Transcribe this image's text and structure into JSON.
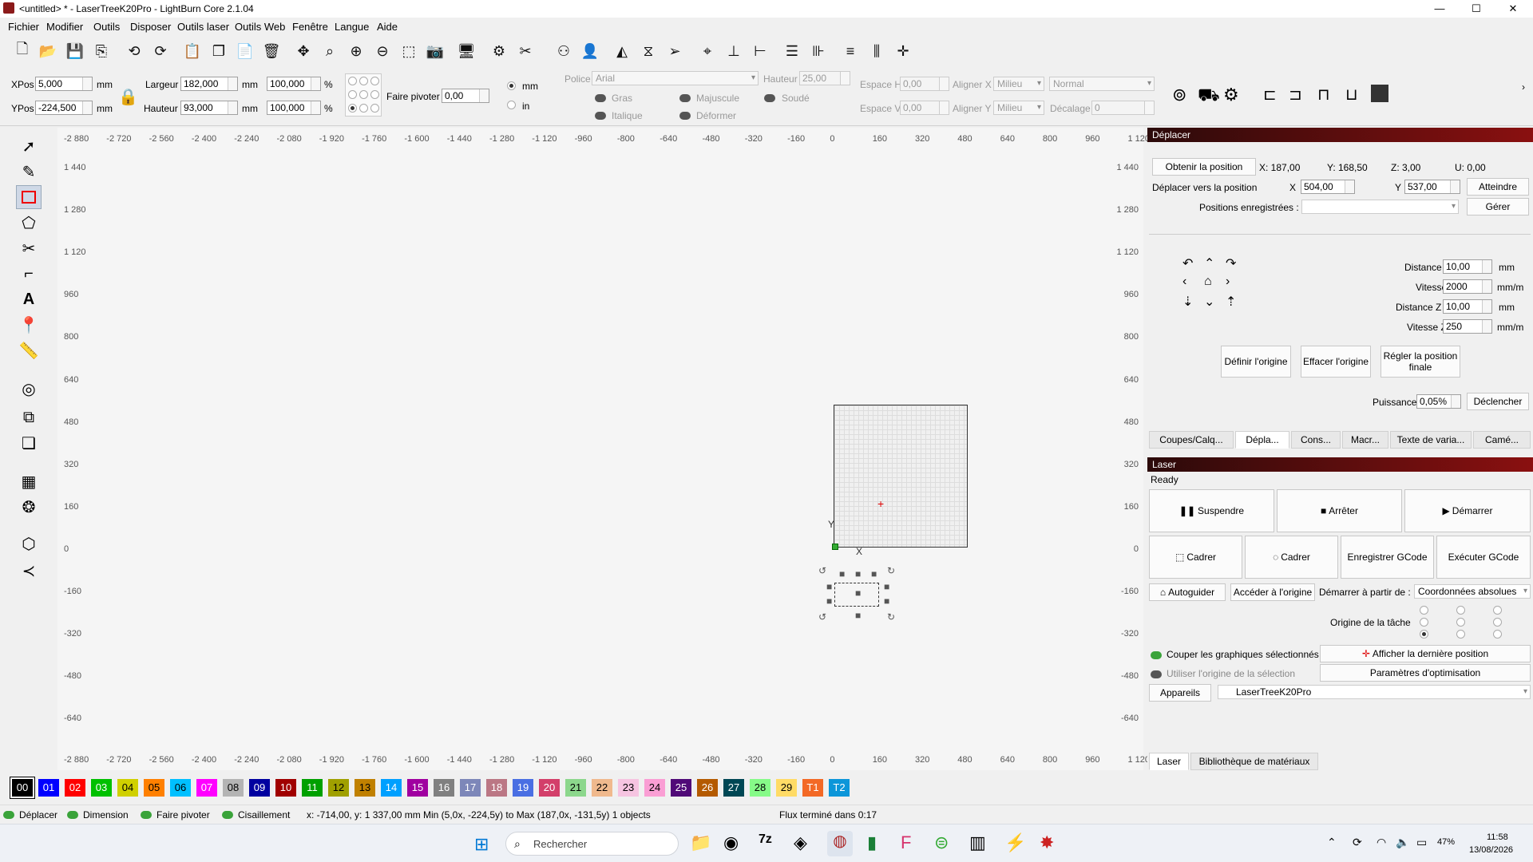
{
  "window": {
    "title": "<untitled> * - LaserTreeK20Pro - LightBurn Core 2.1.04",
    "min": "—",
    "max": "☐",
    "close": "✕"
  },
  "menu": [
    "Fichier",
    "Modifier",
    "Outils",
    "Disposer",
    "Outils laser",
    "Outils Web",
    "Fenêtre",
    "Langue",
    "Aide"
  ],
  "props": {
    "xpos_label": "XPos",
    "xpos": "5,000",
    "ypos_label": "YPos",
    "ypos": "-224,500",
    "unit_mm": "mm",
    "largeur_label": "Largeur",
    "largeur": "182,000",
    "hauteur_label": "Hauteur",
    "hauteur": "93,000",
    "pct1": "100,000",
    "pct2": "100,000",
    "pct_sign": "%",
    "rotate_label": "Faire pivoter",
    "rotate": "0,00",
    "radio_mm": "mm",
    "radio_in": "in",
    "police_label": "Police",
    "police": "Arial",
    "hauteur_font_label": "Hauteur",
    "hauteur_font": "25,00",
    "gras": "Gras",
    "italique": "Italique",
    "majuscule": "Majuscule",
    "deformer": "Déformer",
    "soude": "Soudé",
    "espace_h_label": "Espace H",
    "espace_h": "0,00",
    "espace_v_label": "Espace V",
    "espace_v": "0,00",
    "aligner_x_label": "Aligner X",
    "aligner_x": "Milieu",
    "aligner_y_label": "Aligner Y",
    "aligner_y": "Milieu",
    "normal": "Normal",
    "decalage_label": "Décalage",
    "decalage": "0"
  },
  "ruler": {
    "top": [
      "-2 880",
      "-2 720",
      "-2 560",
      "-2 400",
      "-2 240",
      "-2 080",
      "-1 920",
      "-1 760",
      "-1 600",
      "-1 440",
      "-1 280",
      "-1 120",
      "-960",
      "-800",
      "-640",
      "-480",
      "-320",
      "-160",
      "0",
      "160",
      "320",
      "480",
      "640",
      "800",
      "960",
      "1 120"
    ],
    "left": [
      "1 440",
      "1 280",
      "1 120",
      "960",
      "800",
      "640",
      "480",
      "320",
      "160",
      "0",
      "-160",
      "-320",
      "-480",
      "-640"
    ],
    "axis_x": "X",
    "axis_y": "Y"
  },
  "move_panel": {
    "title": "Déplacer",
    "get_pos": "Obtenir la position",
    "x": "X: 187,00",
    "y": "Y: 168,50",
    "z": "Z: 3,00",
    "u": "U: 0,00",
    "move_to": "Déplacer vers la position",
    "mx_label": "X",
    "mx": "504,00",
    "my_label": "Y",
    "my": "537,00",
    "goto": "Atteindre",
    "saved_label": "Positions enregistrées :",
    "manage": "Gérer",
    "distance_label": "Distance",
    "distance": "10,00",
    "vitesse_label": "Vitesse",
    "vitesse": "2000",
    "distz_label": "Distance Z",
    "distz": "10,00",
    "vitz_label": "Vitesse Z",
    "vitz": "250",
    "mm": "mm",
    "mmm": "mm/m",
    "set_origin": "Définir l'origine",
    "clear_origin": "Effacer l'origine",
    "set_home": "Régler la position finale",
    "power_label": "Puissance",
    "power": "0,05%",
    "fire": "Déclencher"
  },
  "tabs": [
    "Coupes/Calq...",
    "Dépla...",
    "Cons...",
    "Macr...",
    "Texte de varia...",
    "Camé..."
  ],
  "laser_panel": {
    "title": "Laser",
    "status": "Ready",
    "pause": "Suspendre",
    "stop": "Arrêter",
    "start": "Démarrer",
    "frame1": "Cadrer",
    "frame2": "Cadrer",
    "save_gcode": "Enregistrer GCode",
    "run_gcode": "Exécuter GCode",
    "home": "Autoguider",
    "goto_origin": "Accéder à l'origine",
    "start_from_label": "Démarrer à partir de :",
    "start_from": "Coordonnées absolues",
    "job_origin": "Origine de la tâche",
    "cut_selected": "Couper les graphiques sélectionnés",
    "use_sel_origin": "Utiliser l'origine de la sélection",
    "show_last": "Afficher la dernière position",
    "optim": "Paramètres d'optimisation",
    "devices": "Appareils",
    "device": "LaserTreeK20Pro"
  },
  "bottom_tabs": [
    "Laser",
    "Bibliothèque de matériaux"
  ],
  "palette": [
    {
      "l": "00",
      "c": "#000000",
      "t": "#fff"
    },
    {
      "l": "01",
      "c": "#0000ff",
      "t": "#fff"
    },
    {
      "l": "02",
      "c": "#ff0000",
      "t": "#fff"
    },
    {
      "l": "03",
      "c": "#00c000",
      "t": "#fff"
    },
    {
      "l": "04",
      "c": "#d0d000",
      "t": "#000"
    },
    {
      "l": "05",
      "c": "#ff8000",
      "t": "#000"
    },
    {
      "l": "06",
      "c": "#00c0ff",
      "t": "#000"
    },
    {
      "l": "07",
      "c": "#ff00ff",
      "t": "#fff"
    },
    {
      "l": "08",
      "c": "#b4b4b4",
      "t": "#000"
    },
    {
      "l": "09",
      "c": "#0000a0",
      "t": "#fff"
    },
    {
      "l": "10",
      "c": "#a00000",
      "t": "#fff"
    },
    {
      "l": "11",
      "c": "#00a000",
      "t": "#fff"
    },
    {
      "l": "12",
      "c": "#a0a000",
      "t": "#000"
    },
    {
      "l": "13",
      "c": "#c08000",
      "t": "#000"
    },
    {
      "l": "14",
      "c": "#00a0ff",
      "t": "#fff"
    },
    {
      "l": "15",
      "c": "#a000a0",
      "t": "#fff"
    },
    {
      "l": "16",
      "c": "#808080",
      "t": "#fff"
    },
    {
      "l": "17",
      "c": "#7d87b9",
      "t": "#fff"
    },
    {
      "l": "18",
      "c": "#bb7784",
      "t": "#fff"
    },
    {
      "l": "19",
      "c": "#4a6fe3",
      "t": "#fff"
    },
    {
      "l": "20",
      "c": "#d33f6a",
      "t": "#fff"
    },
    {
      "l": "21",
      "c": "#8cd78c",
      "t": "#000"
    },
    {
      "l": "22",
      "c": "#f0b98d",
      "t": "#000"
    },
    {
      "l": "23",
      "c": "#f6c4e1",
      "t": "#000"
    },
    {
      "l": "24",
      "c": "#fa9ed4",
      "t": "#000"
    },
    {
      "l": "25",
      "c": "#500a78",
      "t": "#fff"
    },
    {
      "l": "26",
      "c": "#b45a00",
      "t": "#fff"
    },
    {
      "l": "27",
      "c": "#004754",
      "t": "#fff"
    },
    {
      "l": "28",
      "c": "#86fa88",
      "t": "#000"
    },
    {
      "l": "29",
      "c": "#ffdb66",
      "t": "#000"
    },
    {
      "l": "T1",
      "c": "#f36926",
      "t": "#fff"
    },
    {
      "l": "T2",
      "c": "#0c96d9",
      "t": "#fff"
    }
  ],
  "status": {
    "move": "Déplacer",
    "dimension": "Dimension",
    "rotate": "Faire pivoter",
    "shear": "Cisaillement",
    "coords": "x: -714,00, y: 1 337,00 mm",
    "range": "Min (5,0x, -224,5y) to Max (187,0x, -131,5y)  1 objects",
    "stream": "Flux terminé dans 0:17"
  },
  "taskbar": {
    "search": "Rechercher",
    "time": "11:58",
    "date": "13/08/2026",
    "battery": "47%"
  }
}
